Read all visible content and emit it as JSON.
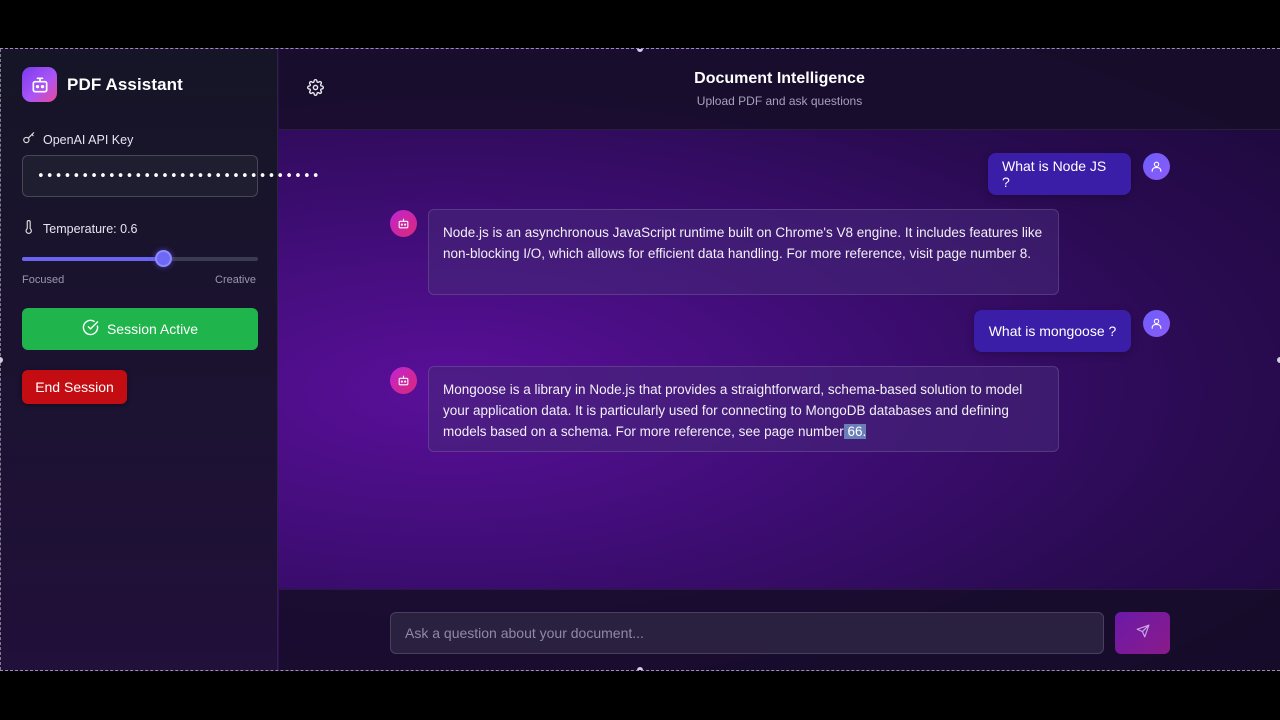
{
  "sidebar": {
    "brand": {
      "title": "PDF Assistant",
      "icon": "robot-icon"
    },
    "api_key": {
      "label": "OpenAI API Key",
      "icon": "key-icon",
      "value": "••••••••••••••••••••••••••••••••"
    },
    "temperature": {
      "label": "Temperature: 0.6",
      "icon": "thermometer-icon",
      "value": 0.6,
      "min_label": "Focused",
      "max_label": "Creative"
    },
    "session_button": {
      "label": "Session Active",
      "icon": "check-circle-icon",
      "color": "#1fb44c"
    },
    "end_button": {
      "label": "End Session",
      "color": "#c40d12"
    }
  },
  "header": {
    "title": "Document Intelligence",
    "subtitle": "Upload PDF and ask questions",
    "settings_icon": "gear-icon"
  },
  "messages": [
    {
      "role": "user",
      "text": "What is Node JS ?"
    },
    {
      "role": "assistant",
      "text": "Node.js is an asynchronous JavaScript runtime built on Chrome's V8 engine. It includes features like non-blocking I/O, which allows for efficient data handling. For more reference, visit page number 8."
    },
    {
      "role": "user",
      "text": "What is mongoose ?"
    },
    {
      "role": "assistant",
      "text_before": "Mongoose is a library in Node.js that provides a straightforward, schema-based solution to model your application data. It is particularly used for connecting to MongoDB databases and defining models based on a schema. For more reference, see page number",
      "text_highlight": " 66."
    }
  ],
  "composer": {
    "placeholder": "Ask a question about your document...",
    "send_icon": "send-icon"
  }
}
